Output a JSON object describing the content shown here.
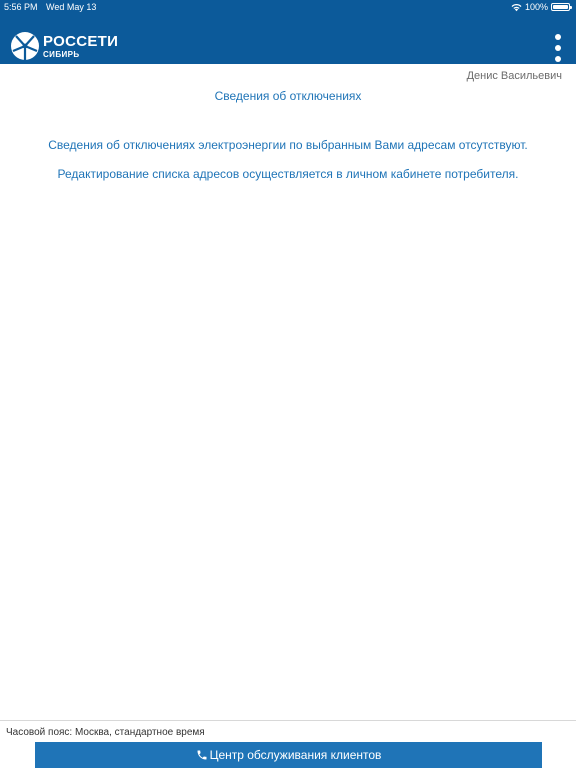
{
  "status_bar": {
    "time": "5:56 PM",
    "date": "Wed May 13",
    "battery": "100%",
    "icons": [
      "wifi-icon",
      "battery-icon"
    ]
  },
  "app_bar": {
    "logo_title": "РОССЕТИ",
    "logo_subtitle": "СИБИРЬ",
    "menu_icon": "more-vertical-icon",
    "background_color": "#0c5a9a"
  },
  "user": {
    "name": "Денис Васильевич"
  },
  "main": {
    "title": "Сведения об отключениях",
    "messages": [
      "Сведения об отключениях электроэнергии по выбранным Вами адресам отсутствуют.",
      "Редактирование списка адресов осуществляется в личном кабинете потребителя."
    ],
    "accent_color": "#1f74b7"
  },
  "footer": {
    "timezone": "Часовой пояс: Москва, стандартное время",
    "service_button_label": "Центр обслуживания клиентов",
    "service_button_icon": "phone-icon"
  }
}
